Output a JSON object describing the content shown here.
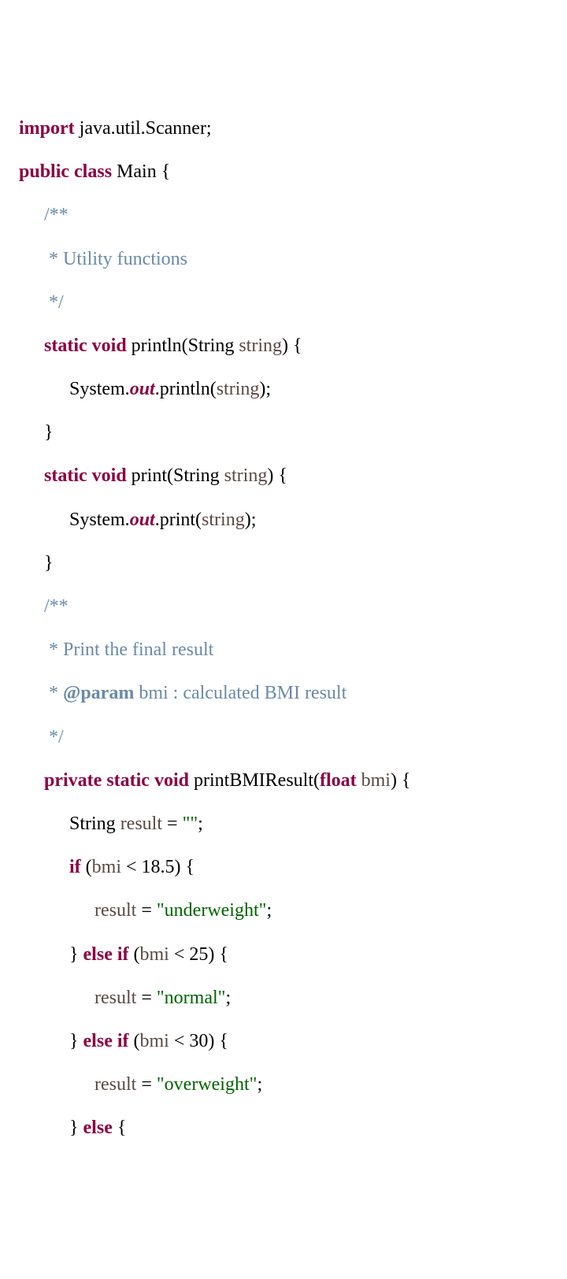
{
  "code": {
    "l1": {
      "kw": "import",
      "rest": " java.util.Scanner;"
    },
    "l2": {
      "kw1": "public",
      "kw2": "class",
      "rest": " Main {"
    },
    "l3": "/**",
    "l4": " * Utility functions",
    "l5": " */",
    "l6": {
      "kw1": "static",
      "kw2": "void",
      "name": " println(String ",
      "param": "string",
      "close": ") {"
    },
    "l7": {
      "pre": "System.",
      "out": "out",
      "post": ".println(",
      "arg": "string",
      "close": ");"
    },
    "l8": "}",
    "l9": {
      "kw1": "static",
      "kw2": "void",
      "name": " print(String ",
      "param": "string",
      "close": ") {"
    },
    "l10": {
      "pre": "System.",
      "out": "out",
      "post": ".print(",
      "arg": "string",
      "close": ");"
    },
    "l11": "}",
    "l12": "/**",
    "l13": " * Print the final result",
    "l14": {
      "pre": " * ",
      "tag": "@param",
      "rest": " bmi : calculated BMI result"
    },
    "l15": " */",
    "l16": {
      "kw1": "private",
      "kw2": "static",
      "kw3": "void",
      "name": " printBMIResult(",
      "kw4": "float",
      "param": " bmi",
      "close": ") {"
    },
    "l17": {
      "pre": "String ",
      "var": "result ",
      "eq": "= ",
      "str": "\"\"",
      "semi": ";"
    },
    "l18": {
      "kw": "if",
      "pre": " (",
      "var": "bmi ",
      "rest": "< 18.5) {"
    },
    "l19": {
      "var": "result ",
      "eq": "= ",
      "str": "\"underweight\"",
      "semi": ";"
    },
    "l20": {
      "brace": "} ",
      "kw": "else if",
      "pre": " (",
      "var": "bmi ",
      "rest": "< 25) {"
    },
    "l21": {
      "var": "result ",
      "eq": "= ",
      "str": "\"normal\"",
      "semi": ";"
    },
    "l22": {
      "brace": "} ",
      "kw": "else if",
      "pre": " (",
      "var": "bmi ",
      "rest": "< 30) {"
    },
    "l23": {
      "var": "result ",
      "eq": "= ",
      "str": "\"overweight\"",
      "semi": ";"
    },
    "l24": {
      "brace": "} ",
      "kw": "else",
      "rest": " {"
    }
  }
}
